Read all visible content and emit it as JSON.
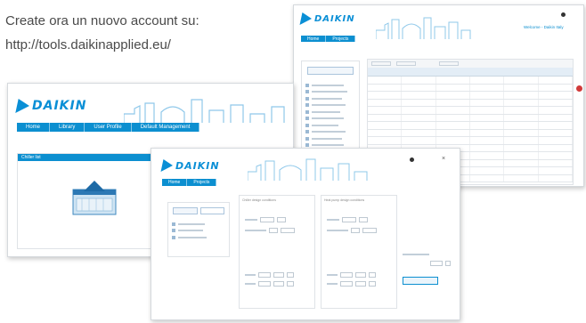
{
  "headline": {
    "line1": "Create ora un nuovo account su:",
    "line2": "http://tools.daikinapplied.eu/"
  },
  "brand": {
    "name": "DAIKIN",
    "color": "#0a8fd6",
    "nav_color": "#0c8fd0"
  },
  "screens": {
    "left": {
      "nav_tabs": [
        "Home",
        "Library",
        "User Profile",
        "Default Management"
      ],
      "panel_title": "Chiller list",
      "unit_icon": "chiller-unit-icon"
    },
    "right": {
      "nav_tabs": [
        "Home",
        "Projects"
      ],
      "user_label": "Welcome - Daikin Italy"
    },
    "front": {
      "nav_tabs": [
        "Home",
        "Projects"
      ],
      "section_left_title": "Chiller design conditions",
      "section_right_title": "Heat pump design conditions"
    }
  }
}
